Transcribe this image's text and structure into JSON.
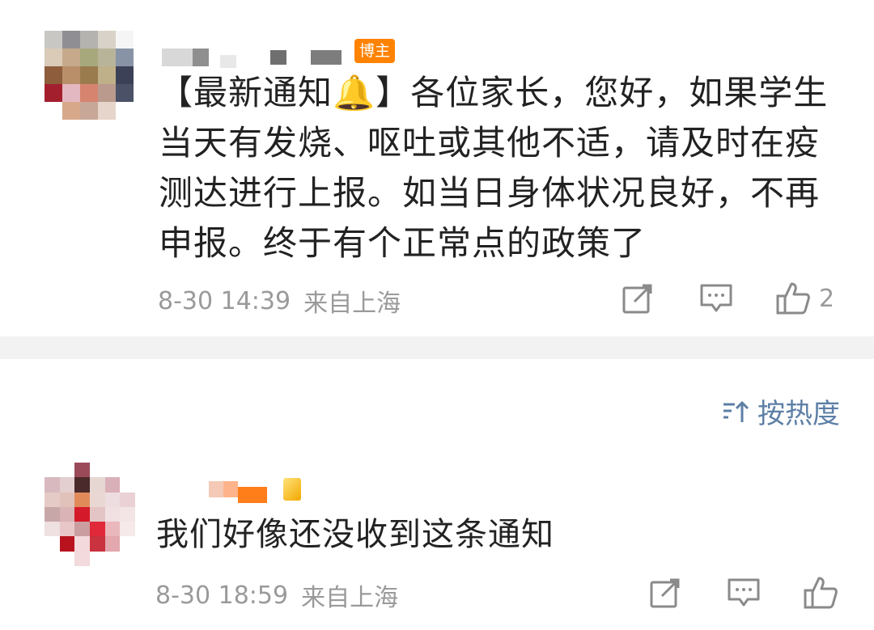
{
  "post": {
    "badge": "博主",
    "content": "【最新通知🔔】各位家长，您好，如果学生当天有发烧、呕吐或其他不适，请及时在疫测达进行上报。如当日身体状况良好，不再申报。终于有个正常点的政策了",
    "time": "8-30 14:39",
    "location": "来自上海",
    "likes": "2"
  },
  "sort": {
    "label": "按热度",
    "icon": "sort-icon"
  },
  "reply": {
    "content": "我们好像还没收到这条通知",
    "time": "8-30 18:59",
    "location": "来自上海"
  },
  "icons": {
    "share": "share-icon",
    "comment": "comment-icon",
    "like": "thumbs-up-icon"
  },
  "colors": {
    "badge": "#ff8200",
    "link": "#5d7fa6",
    "meta": "#9a9a9a",
    "divider": "#f2f2f2"
  }
}
